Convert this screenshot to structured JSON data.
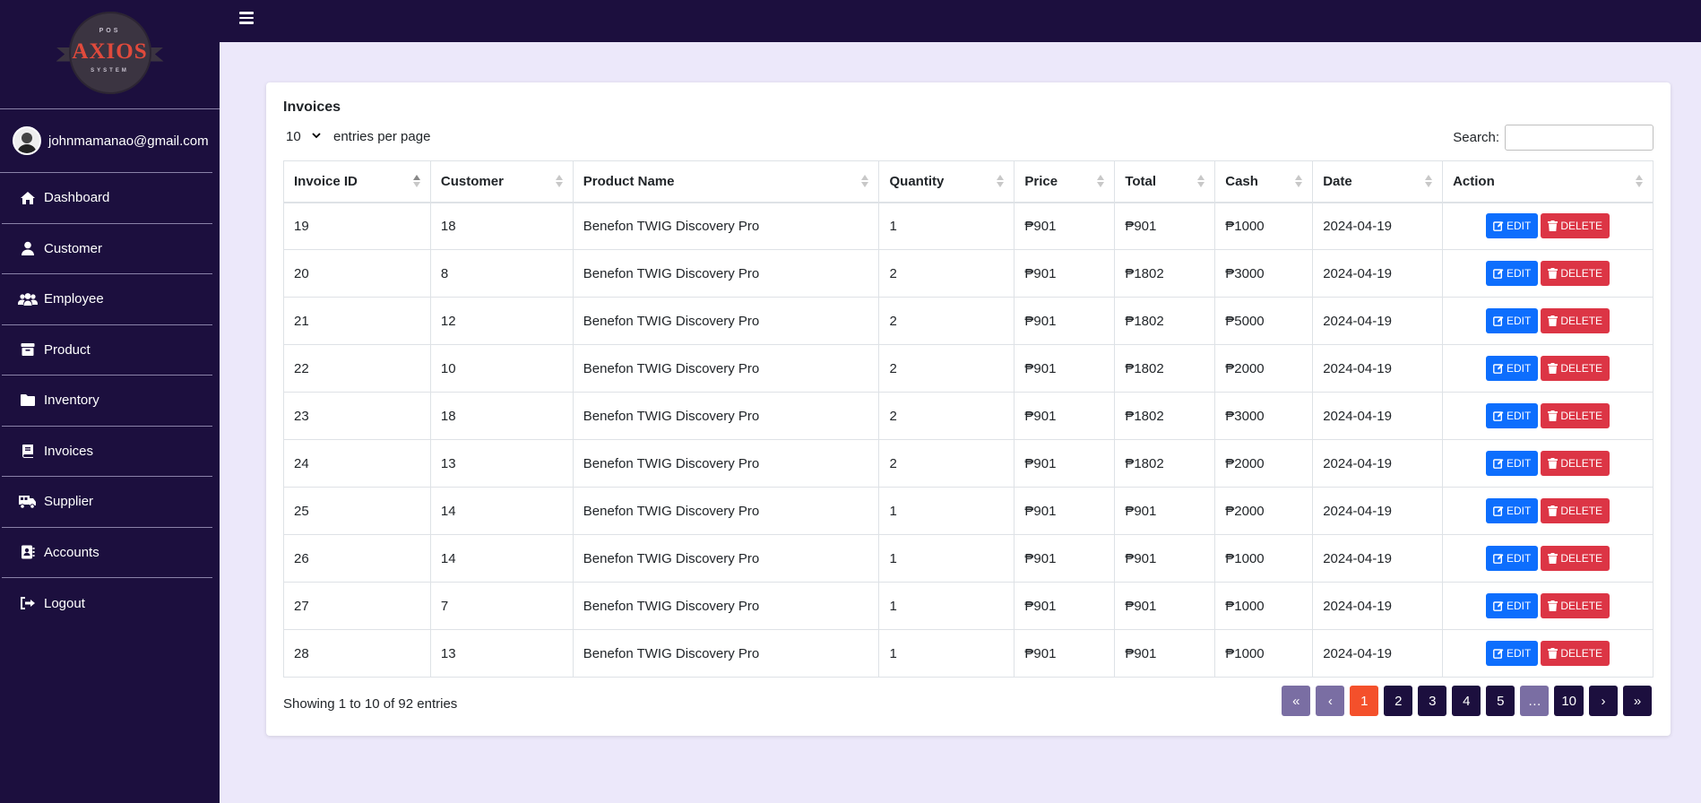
{
  "logo": {
    "top_text": "POS",
    "brand": "AXIOS",
    "bottom_text": "SYSTEM"
  },
  "user": {
    "email": "johnmamanao@gmail.com"
  },
  "nav": [
    {
      "label": "Dashboard",
      "icon": "home-icon"
    },
    {
      "label": "Customer",
      "icon": "user-icon"
    },
    {
      "label": "Employee",
      "icon": "users-icon"
    },
    {
      "label": "Product",
      "icon": "archive-icon"
    },
    {
      "label": "Inventory",
      "icon": "folder-icon"
    },
    {
      "label": "Invoices",
      "icon": "book-icon"
    },
    {
      "label": "Supplier",
      "icon": "truck-icon"
    },
    {
      "label": "Accounts",
      "icon": "address-book-icon"
    },
    {
      "label": "Logout",
      "icon": "logout-icon"
    }
  ],
  "card": {
    "title": "Invoices",
    "length_value": "10",
    "length_label": "entries per page",
    "search_label": "Search:",
    "search_value": ""
  },
  "table": {
    "headers": [
      "Invoice ID",
      "Customer",
      "Product Name",
      "Quantity",
      "Price",
      "Total",
      "Cash",
      "Date",
      "Action"
    ],
    "rows": [
      [
        "19",
        "18",
        "Benefon TWIG Discovery Pro",
        "1",
        "₱901",
        "₱901",
        "₱1000",
        "2024-04-19"
      ],
      [
        "20",
        "8",
        "Benefon TWIG Discovery Pro",
        "2",
        "₱901",
        "₱1802",
        "₱3000",
        "2024-04-19"
      ],
      [
        "21",
        "12",
        "Benefon TWIG Discovery Pro",
        "2",
        "₱901",
        "₱1802",
        "₱5000",
        "2024-04-19"
      ],
      [
        "22",
        "10",
        "Benefon TWIG Discovery Pro",
        "2",
        "₱901",
        "₱1802",
        "₱2000",
        "2024-04-19"
      ],
      [
        "23",
        "18",
        "Benefon TWIG Discovery Pro",
        "2",
        "₱901",
        "₱1802",
        "₱3000",
        "2024-04-19"
      ],
      [
        "24",
        "13",
        "Benefon TWIG Discovery Pro",
        "2",
        "₱901",
        "₱1802",
        "₱2000",
        "2024-04-19"
      ],
      [
        "25",
        "14",
        "Benefon TWIG Discovery Pro",
        "1",
        "₱901",
        "₱901",
        "₱2000",
        "2024-04-19"
      ],
      [
        "26",
        "14",
        "Benefon TWIG Discovery Pro",
        "1",
        "₱901",
        "₱901",
        "₱1000",
        "2024-04-19"
      ],
      [
        "27",
        "7",
        "Benefon TWIG Discovery Pro",
        "1",
        "₱901",
        "₱901",
        "₱1000",
        "2024-04-19"
      ],
      [
        "28",
        "13",
        "Benefon TWIG Discovery Pro",
        "1",
        "₱901",
        "₱901",
        "₱1000",
        "2024-04-19"
      ]
    ],
    "edit_label": "EDIT",
    "delete_label": "DELETE"
  },
  "info": "Showing 1 to 10 of 92 entries",
  "pagination": [
    {
      "label": "«",
      "state": "muted"
    },
    {
      "label": "‹",
      "state": "muted"
    },
    {
      "label": "1",
      "state": "current"
    },
    {
      "label": "2",
      "state": "normal"
    },
    {
      "label": "3",
      "state": "normal"
    },
    {
      "label": "4",
      "state": "normal"
    },
    {
      "label": "5",
      "state": "normal"
    },
    {
      "label": "…",
      "state": "muted"
    },
    {
      "label": "10",
      "state": "normal"
    },
    {
      "label": "›",
      "state": "normal"
    },
    {
      "label": "»",
      "state": "normal"
    }
  ],
  "colors": {
    "sidebar_bg": "#1c0f3e",
    "page_bg": "#ece8fa",
    "edit": "#0d6efd",
    "delete": "#dc3545",
    "page_current": "#f4502b",
    "page_muted": "#7a6ea3"
  }
}
